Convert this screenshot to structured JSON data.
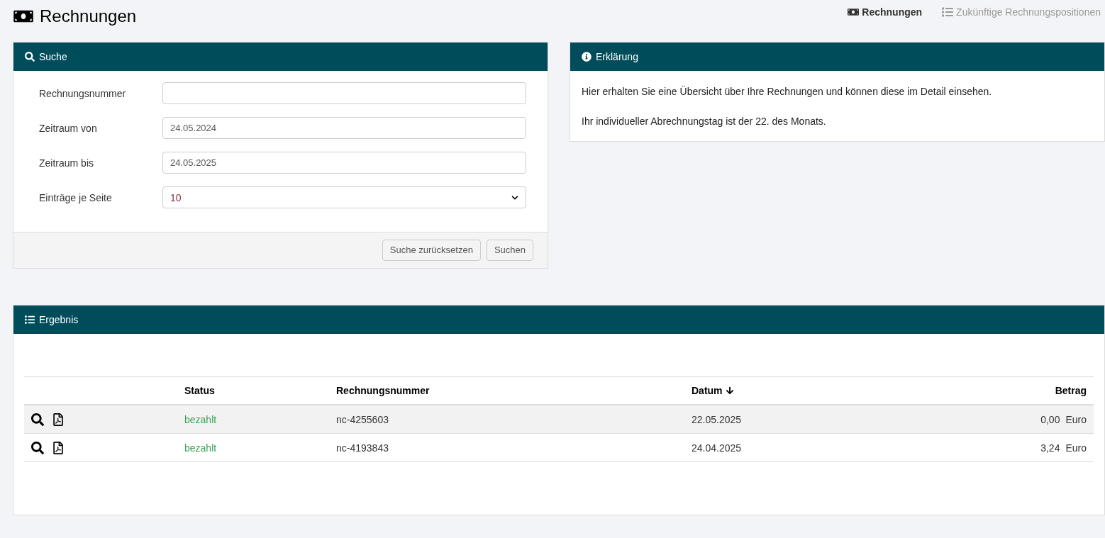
{
  "page_title": "Rechnungen",
  "nav": [
    {
      "label": "Rechnungen",
      "kind": "money",
      "selected": true
    },
    {
      "label": "Zukünftige Rechnungspositionen",
      "kind": "list",
      "selected": false
    }
  ],
  "search_panel": {
    "title": "Suche",
    "fields": [
      {
        "label": "Rechnungsnummer",
        "kind": "text"
      },
      {
        "label": "Zeitraum von",
        "kind": "text",
        "value": "24.05.2024"
      },
      {
        "label": "Zeitraum bis",
        "kind": "text",
        "value": "24.05.2025"
      },
      {
        "label": "Einträge je Seite",
        "kind": "select",
        "value": "10"
      }
    ],
    "buttons": [
      "Suche zurücksetzen",
      "Suchen"
    ]
  },
  "info_panel": {
    "title": "Erklärung",
    "paragraphs": [
      "Hier erhalten Sie eine Übersicht über Ihre Rechnungen und können diese im Detail einsehen.",
      "Ihr individueller Abrechnungstag ist der 22. des Monats."
    ]
  },
  "result_panel": {
    "title": "Ergebnis",
    "columns": [
      {
        "label": "Status",
        "sorted": false
      },
      {
        "label": "Rechnungsnummer",
        "sorted": false
      },
      {
        "label": "Datum",
        "sorted": true
      },
      {
        "label": "Betrag",
        "sorted": false
      }
    ],
    "rows": [
      {
        "selected": true,
        "status": "bezahlt",
        "number": "nc-4255603",
        "date": "22.05.2025",
        "amount": "0,00",
        "currency": "Euro"
      },
      {
        "selected": false,
        "status": "bezahlt",
        "number": "nc-4193843",
        "date": "24.04.2025",
        "amount": "3,24",
        "currency": "Euro"
      }
    ]
  }
}
